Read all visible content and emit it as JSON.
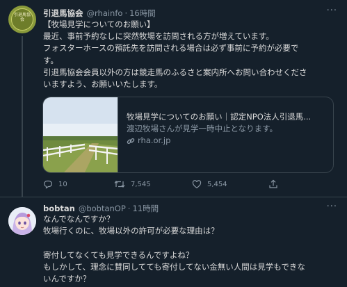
{
  "tweet1": {
    "avatar_text": "引退馬協会",
    "name": "引退馬協会",
    "handle": "@rhainfo",
    "dot": "·",
    "time": "16時間",
    "more": "···",
    "lines": [
      "【牧場見学についてのお願い】",
      "最近、事前予約なしに突然牧場を訪問される方が増えています。",
      "フォスターホースの預託先を訪問される場合は必ず事前に予約が必要で",
      "す。",
      "引退馬協会会員以外の方は競走馬のふるさと案内所へお問い合わせくださ",
      "いますよう、お願いいたします。"
    ],
    "card": {
      "title": "牧場見学についてのお願い｜認定NPO法人引退馬...",
      "description": "渡辺牧場さんが見学一時中止となります。",
      "domain": "rha.or.jp",
      "icon": "link-icon"
    },
    "actions": {
      "replies": "10",
      "retweets": "7,545",
      "likes": "5,454",
      "icons": [
        "reply-icon",
        "retweet-icon",
        "like-icon",
        "share-icon"
      ]
    }
  },
  "tweet2": {
    "name": "bobtan",
    "handle": "@bobtanOP",
    "dot": "·",
    "time": "11時間",
    "more": "···",
    "lines": [
      "なんでなんですか？",
      "牧場行くのに、牧場以外の許可が必要な理由は？",
      "",
      "寄付してなくても見学できるんですよね？",
      "もしかして、理念に賛同してても寄付してない金無い人間は見学もできな",
      "いんですか？"
    ]
  },
  "colors": {
    "background": "#15202b",
    "text": "#d9d9d9",
    "secondary_text": "#8b98a5",
    "border": "#38444d"
  }
}
